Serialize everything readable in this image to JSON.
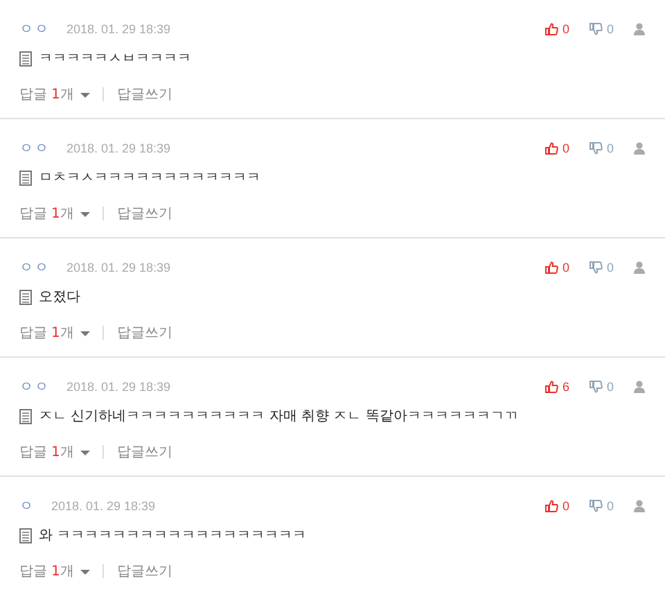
{
  "comments": [
    {
      "author": "ㅇㅇ",
      "date": "2018. 01. 29 18:39",
      "text": "ㅋㅋㅋㅋㅋㅅㅂㅋㅋㅋㅋ",
      "likes": "0",
      "dislikes": "0",
      "reply_label": "답글",
      "reply_count": "1",
      "reply_unit": "개",
      "write_label": "답글쓰기"
    },
    {
      "author": "ㅇㅇ",
      "date": "2018. 01. 29 18:39",
      "text": "ㅁㅊㅋㅅㅋㅋㅋㅋㅋㅋㅋㅋㅋㅋㅋㅋ",
      "likes": "0",
      "dislikes": "0",
      "reply_label": "답글",
      "reply_count": "1",
      "reply_unit": "개",
      "write_label": "답글쓰기"
    },
    {
      "author": "ㅇㅇ",
      "date": "2018. 01. 29 18:39",
      "text": "오졌다",
      "likes": "0",
      "dislikes": "0",
      "reply_label": "답글",
      "reply_count": "1",
      "reply_unit": "개",
      "write_label": "답글쓰기"
    },
    {
      "author": "ㅇㅇ",
      "date": "2018. 01. 29 18:39",
      "text": "ㅈㄴ 신기하네ㅋㅋㅋㅋㅋㅋㅋㅋㅋㅋ 자매 취향 ㅈㄴ 똑같아ㅋㅋㅋㅋㅋㅋㄱㄲ",
      "likes": "6",
      "dislikes": "0",
      "reply_label": "답글",
      "reply_count": "1",
      "reply_unit": "개",
      "write_label": "답글쓰기"
    },
    {
      "author": "ㅇ",
      "date": "2018. 01. 29 18:39",
      "text": "와 ㅋㅋㅋㅋㅋㅋㅋㅋㅋㅋㅋㅋㅋㅋㅋㅋㅋㅋ",
      "likes": "0",
      "dislikes": "0",
      "reply_label": "답글",
      "reply_count": "1",
      "reply_unit": "개",
      "write_label": "답글쓰기"
    }
  ]
}
